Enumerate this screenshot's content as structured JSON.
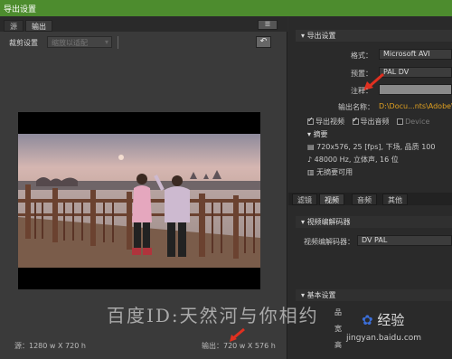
{
  "window": {
    "title": "导出设置"
  },
  "left": {
    "tabs": [
      "源",
      "输出"
    ],
    "crop_label": "裁剪设置",
    "crop_value": "缩放以适配",
    "source_info": "源：1280 w X 720 h",
    "output_info": "输出：720 w X 576 h"
  },
  "export": {
    "section_title": "导出设置",
    "format_label": "格式：",
    "format_value": "Microsoft AVI",
    "preset_label": "预置：",
    "preset_value": "PAL DV",
    "notes_label": "注释：",
    "output_name_label": "输出名称：",
    "output_name_value": "D:\\Docu...nts\\Adobe\\Pr",
    "export_video_label": "导出视频",
    "export_audio_label": "导出音频",
    "device_label": "Device",
    "summary_title": "摘要",
    "summary_lines": [
      "720x576, 25 [fps], 下场, 品质 100",
      "48000 Hz, 立体声, 16 位",
      "无摘要可用"
    ]
  },
  "right_tabs": [
    "滤镜",
    "视频",
    "音频",
    "其他"
  ],
  "video_codec": {
    "section_title": "视频编解码器",
    "codec_label": "视频编解码器：",
    "codec_value": "DV PAL"
  },
  "basic": {
    "section_title": "基本设置",
    "row1": "品",
    "row2": "宽",
    "row3": "高"
  },
  "watermark": {
    "text": "百度ID:天然河与你相约",
    "brand": "经验",
    "url": "jingyan.baidu.com"
  },
  "icons": [
    "dropdown-arrow-icon",
    "undo-icon",
    "panel-menu-icon",
    "triangle-toggle-icon",
    "film-icon",
    "audio-icon",
    "chart-icon",
    "red-arrow-icon"
  ]
}
